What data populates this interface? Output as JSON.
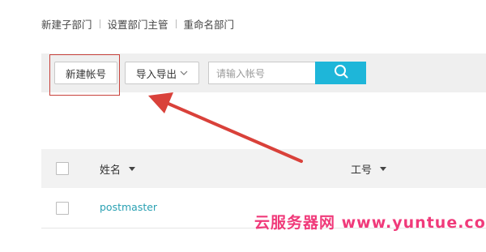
{
  "top_nav": {
    "items": [
      {
        "label": "新建子部门"
      },
      {
        "label": "设置部门主管"
      },
      {
        "label": "重命名部门"
      }
    ]
  },
  "toolbar": {
    "new_account_label": "新建帐号",
    "import_export_label": "导入导出",
    "search_placeholder": "请输入帐号",
    "search_button_icon": "search-icon"
  },
  "table": {
    "columns": [
      {
        "label": "姓名",
        "sortable": true
      },
      {
        "label": "工号",
        "sortable": true
      }
    ],
    "rows": [
      {
        "name": "postmaster",
        "id": ""
      }
    ]
  },
  "annotation": {
    "highlight_color": "#c8423c",
    "arrow_color": "#d9413a"
  },
  "watermark": {
    "text": "云服务器网 www.yuntue.com",
    "color": "#f03a7a"
  },
  "colors": {
    "accent": "#1eb6d9",
    "link": "#2aa1b3"
  }
}
